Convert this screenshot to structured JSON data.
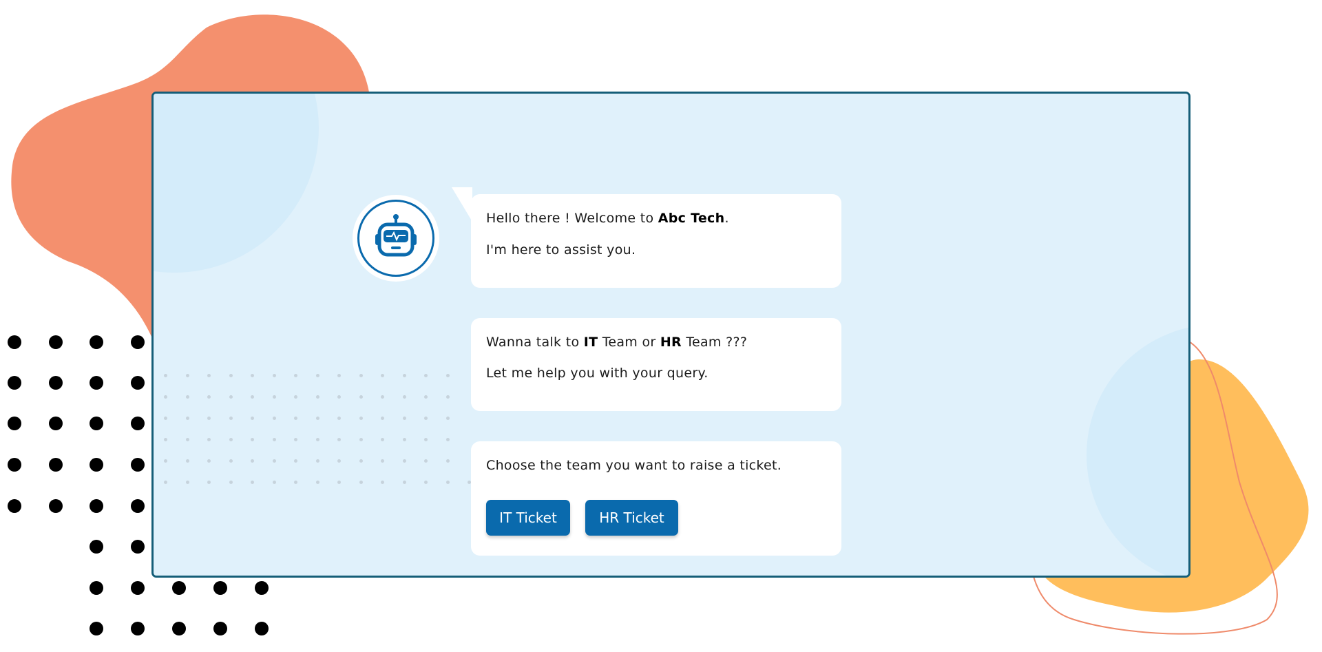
{
  "colors": {
    "accent": "#0a6aad",
    "card_border": "#155e78",
    "card_background": "#e0f1fb",
    "orange_blob": "#f4906e",
    "yellow_blob": "#ffbe5c"
  },
  "avatar": {
    "icon": "robot-icon"
  },
  "messages": [
    {
      "line1_pre": "Hello there ! Welcome to ",
      "line1_bold": "Abc Tech",
      "line1_post": ".",
      "line2": "I'm here to assist you."
    },
    {
      "pre": "Wanna talk to ",
      "bold1": "IT",
      "mid": " Team or ",
      "bold2": "HR",
      "post": " Team ???",
      "line2": "Let me help you with your query."
    },
    {
      "text": "Choose the team you want to raise a ticket."
    }
  ],
  "buttons": {
    "it_ticket": "IT Ticket",
    "hr_ticket": "HR Ticket"
  }
}
